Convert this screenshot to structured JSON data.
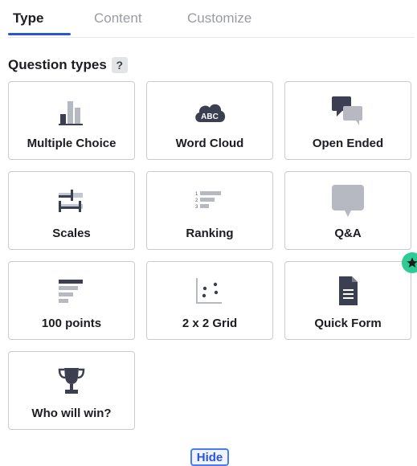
{
  "tabs": [
    {
      "label": "Type",
      "active": true
    },
    {
      "label": "Content",
      "active": false
    },
    {
      "label": "Customize",
      "active": false
    }
  ],
  "section": {
    "title": "Question types",
    "help": "?"
  },
  "cards": [
    {
      "label": "Multiple Choice",
      "icon": "bar-chart-icon"
    },
    {
      "label": "Word Cloud",
      "icon": "cloud-abc-icon"
    },
    {
      "label": "Open Ended",
      "icon": "speech-bubbles-icon"
    },
    {
      "label": "Scales",
      "icon": "sliders-icon"
    },
    {
      "label": "Ranking",
      "icon": "ranking-bars-icon"
    },
    {
      "label": "Q&A",
      "icon": "speech-bubble-icon"
    },
    {
      "label": "100 points",
      "icon": "horizontal-bars-icon"
    },
    {
      "label": "2 x 2 Grid",
      "icon": "scatter-grid-icon"
    },
    {
      "label": "Quick Form",
      "icon": "document-icon",
      "premium": true
    },
    {
      "label": "Who will win?",
      "icon": "trophy-icon"
    }
  ],
  "hide_label": "Hide",
  "colors": {
    "accent": "#2a56d6",
    "icon_dark": "#3b3f51",
    "premium": "#2ecc94"
  }
}
